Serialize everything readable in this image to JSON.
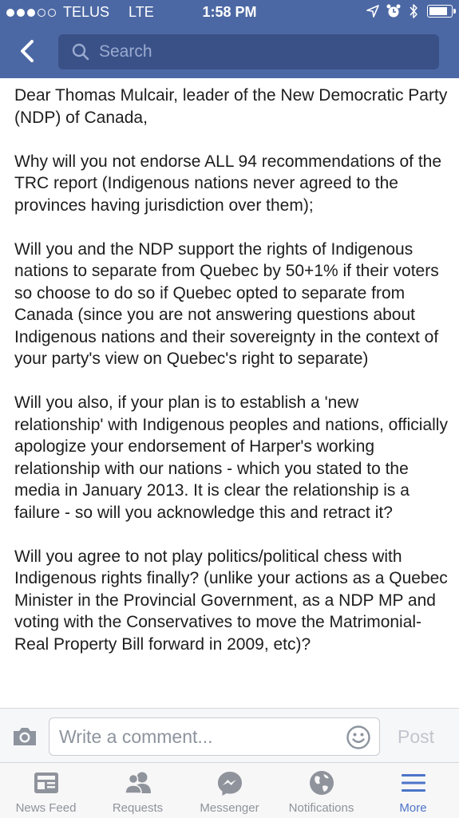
{
  "status_bar": {
    "carrier": "TELUS",
    "network": "LTE",
    "time": "1:58 PM"
  },
  "nav": {
    "search_placeholder": "Search"
  },
  "post": {
    "paragraphs": [
      "Dear Thomas Mulcair, leader of the New Democratic Party (NDP) of Canada,",
      "Why will you not endorse ALL 94 recommendations of the TRC report (Indigenous nations never agreed to the provinces having jurisdiction over them);",
      "Will you and the NDP support the rights of Indigenous nations to separate from Quebec by 50+1% if their voters so choose to do so if Quebec opted to separate from Canada (since you are not answering questions about Indigenous nations and their sovereignty in the context of your party's view on Quebec's right to separate)",
      "Will you also, if your plan is to establish a 'new relationship' with Indigenous peoples and nations, officially apologize your endorsement of Harper's working relationship with our nations - which you stated to the media in January 2013. It is clear the relationship is a failure - so will you acknowledge this and retract it?",
      "Will you agree to not play politics/political chess with Indigenous rights finally? (unlike your actions as a Quebec Minister in the Provincial Government, as a NDP MP and voting with the Conservatives to move the Matrimonial-Real Property Bill forward in 2009, etc)?"
    ]
  },
  "composer": {
    "placeholder": "Write a comment...",
    "post_label": "Post"
  },
  "tabbar": {
    "news_feed": "News Feed",
    "requests": "Requests",
    "messenger": "Messenger",
    "notifications": "Notifications",
    "more": "More"
  },
  "colors": {
    "header": "#4c68a4",
    "search_bg": "#3a5188",
    "active_tab": "#4b74c8",
    "inactive_tab": "#8f939b"
  },
  "icons": {
    "back": "chevron-left-icon",
    "search": "search-icon",
    "camera": "camera-icon",
    "smiley": "smiley-icon",
    "news_feed": "news-feed-icon",
    "requests": "friend-requests-icon",
    "messenger": "messenger-icon",
    "notifications": "globe-icon",
    "more": "hamburger-menu-icon"
  }
}
